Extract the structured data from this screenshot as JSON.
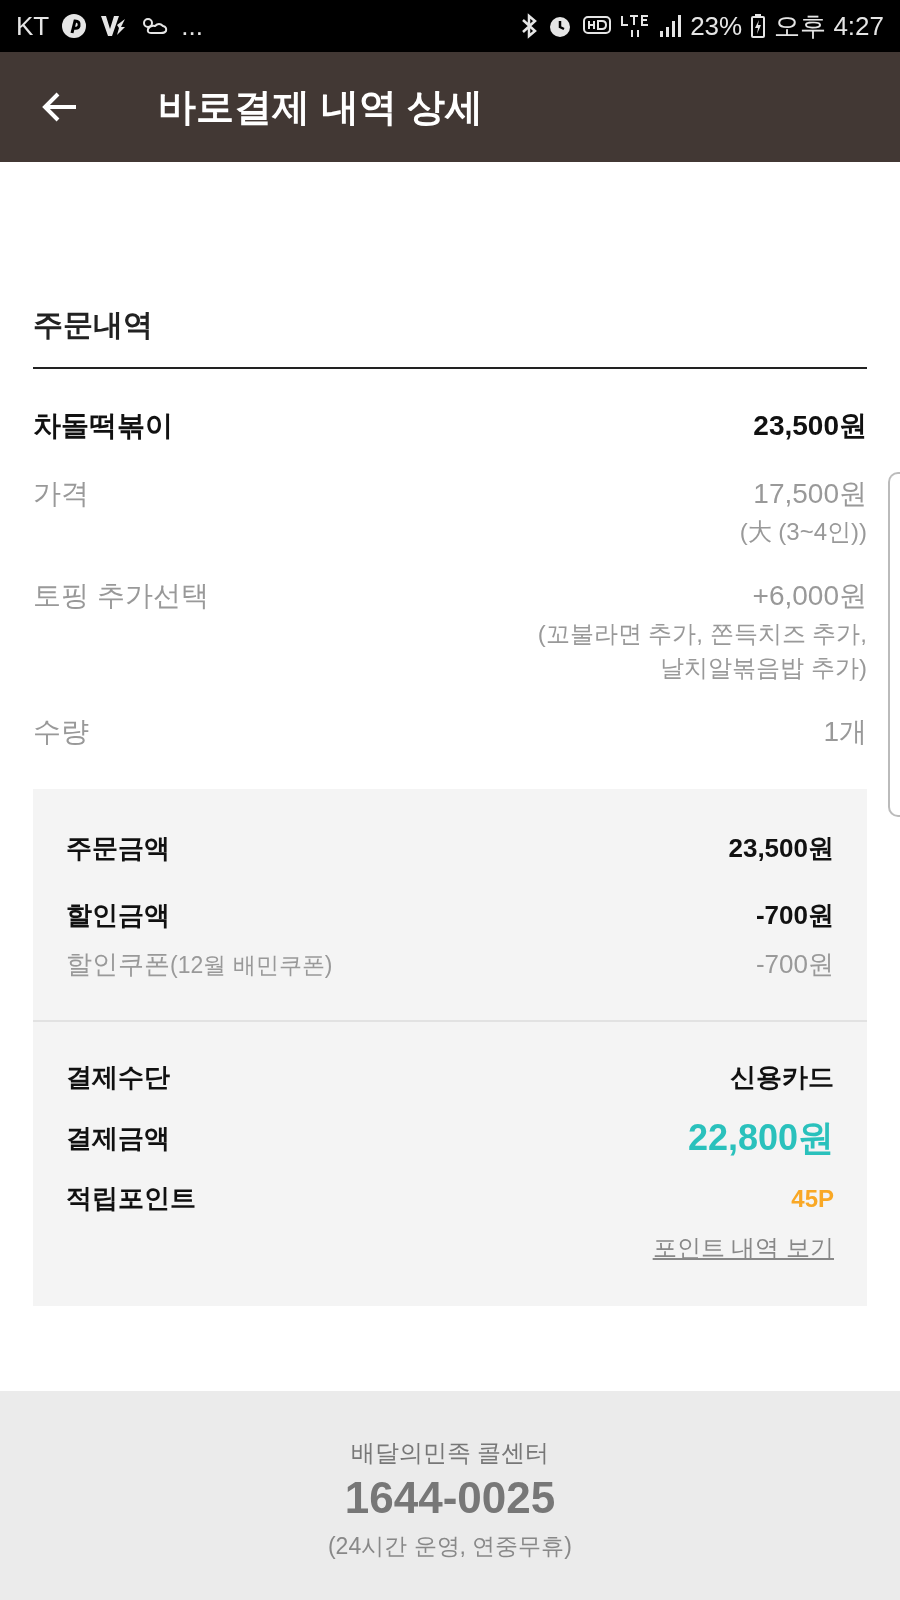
{
  "status_bar": {
    "carrier": "KT",
    "more": "...",
    "battery": "23%",
    "time": "오후 4:27"
  },
  "header": {
    "title": "바로결제 내역 상세"
  },
  "order": {
    "heading": "주문내역",
    "menu_name": "차돌떡볶이",
    "menu_total": "23,500원",
    "details": [
      {
        "label": "가격",
        "value": "17,500원",
        "notes": [
          "(大 (3~4인))"
        ]
      },
      {
        "label": "토핑 추가선택",
        "value": "+6,000원",
        "notes": [
          "(꼬불라면 추가, 쫀득치즈 추가,",
          "날치알볶음밥 추가)"
        ]
      },
      {
        "label": "수량",
        "value": "1개"
      }
    ]
  },
  "summary": {
    "order_amount": {
      "label": "주문금액",
      "value": "23,500원"
    },
    "discount": {
      "label": "할인금액",
      "value": "-700원"
    },
    "coupon": {
      "label": "할인쿠폰",
      "detail": "(12월 배민쿠폰)",
      "value": "-700원"
    },
    "payment_method": {
      "label": "결제수단",
      "value": "신용카드"
    },
    "payment_amount": {
      "label": "결제금액",
      "value": "22,800원"
    },
    "points": {
      "label": "적립포인트",
      "value": "45P"
    },
    "points_link": "포인트 내역 보기"
  },
  "footer": {
    "title": "배달의민족 콜센터",
    "phone": "1644-0025",
    "hours": "(24시간 운영, 연중무휴)"
  }
}
